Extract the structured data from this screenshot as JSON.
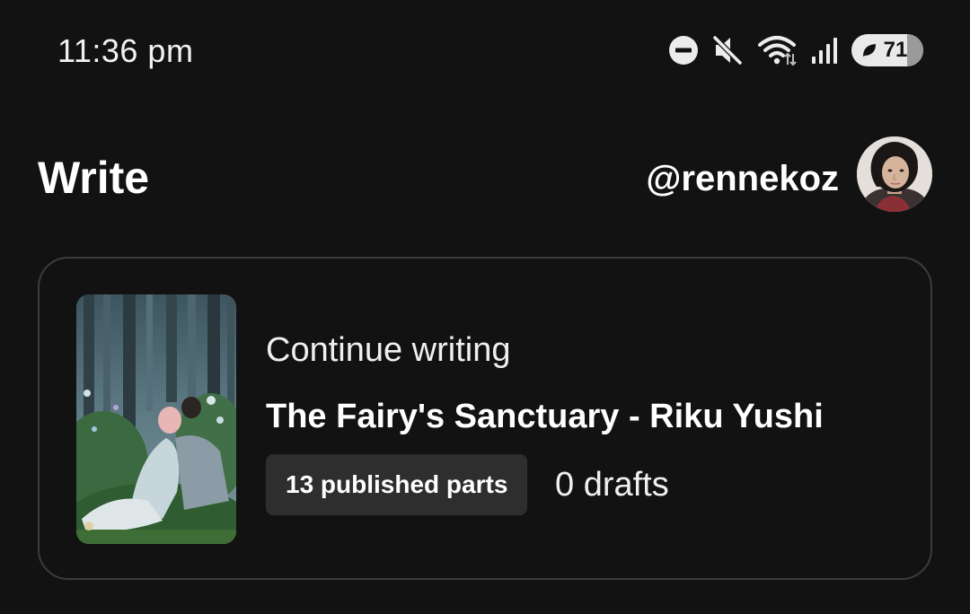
{
  "status_bar": {
    "time": "11:36 pm",
    "battery_level": "71",
    "icons": [
      "do-not-disturb-icon",
      "mute-icon",
      "wifi-icon",
      "signal-icon",
      "battery-saver-icon"
    ]
  },
  "header": {
    "title": "Write",
    "username": "@rennekoz"
  },
  "continue_card": {
    "label": "Continue writing",
    "story_title": "The Fairy's Sanctuary - Riku Yushi",
    "published_parts": "13 published parts",
    "drafts": "0 drafts"
  },
  "colors": {
    "background": "#121212",
    "card_border": "#3c3c3c",
    "chip_background": "#2e2e2e",
    "text": "#ffffff"
  }
}
